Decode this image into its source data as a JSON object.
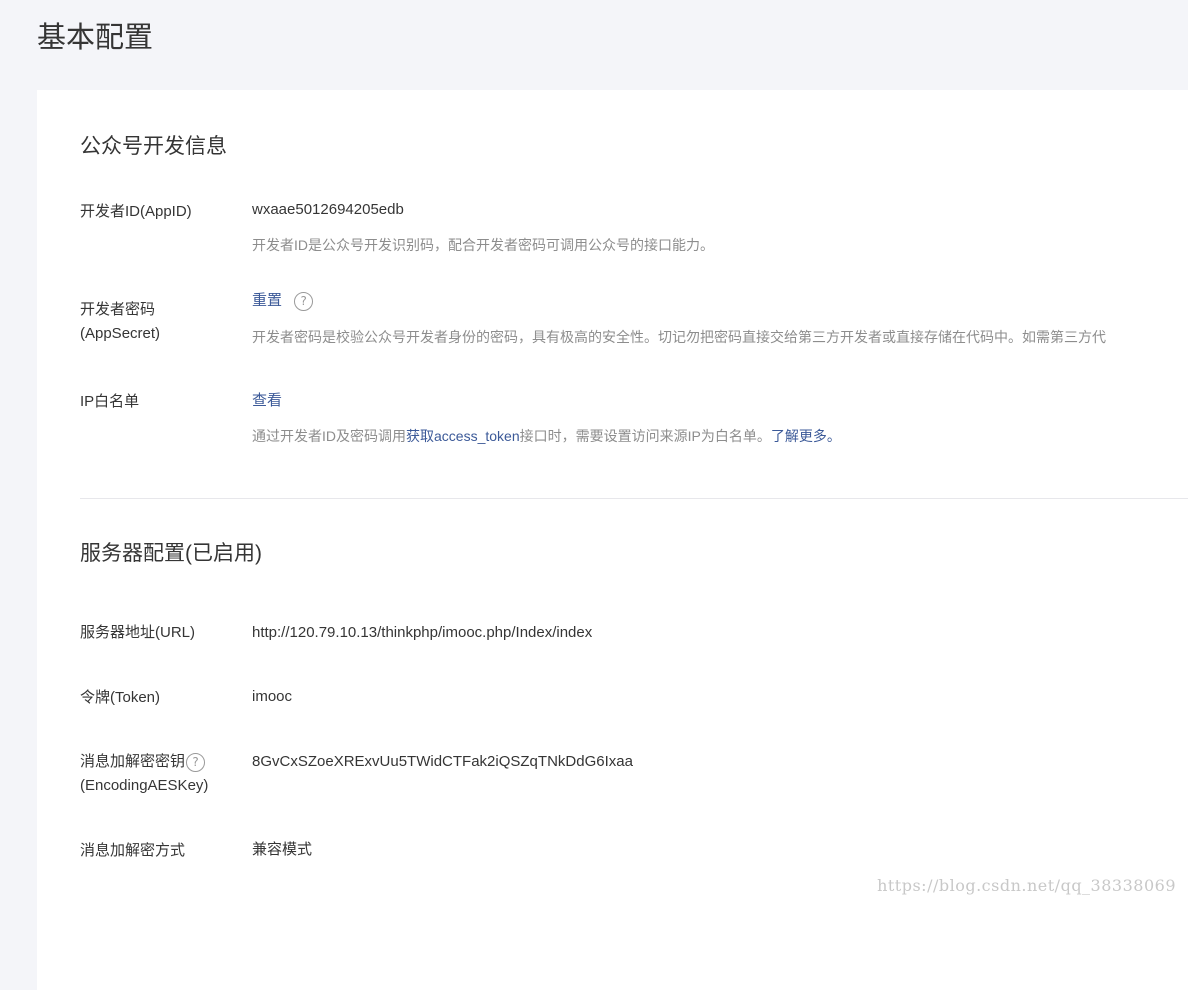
{
  "page_title": "基本配置",
  "dev_info": {
    "title": "公众号开发信息",
    "appid": {
      "label": "开发者ID(AppID)",
      "value": "wxaae5012694205edb",
      "desc": "开发者ID是公众号开发识别码，配合开发者密码可调用公众号的接口能力。"
    },
    "appsecret": {
      "label_line1": "开发者密码",
      "label_line2": "(AppSecret)",
      "action": "重置",
      "help": "?",
      "desc": "开发者密码是校验公众号开发者身份的密码，具有极高的安全性。切记勿把密码直接交给第三方开发者或直接存储在代码中。如需第三方代"
    },
    "ip_whitelist": {
      "label": "IP白名单",
      "action": "查看",
      "desc_prefix": "通过开发者ID及密码调用",
      "desc_link1": "获取access_token",
      "desc_middle": "接口时，需要设置访问来源IP为白名单。",
      "desc_link2": "了解更多。"
    }
  },
  "server_config": {
    "title": "服务器配置(已启用)",
    "url": {
      "label": "服务器地址(URL)",
      "value": "http://120.79.10.13/thinkphp/imooc.php/Index/index"
    },
    "token": {
      "label": "令牌(Token)",
      "value": "imooc"
    },
    "aeskey": {
      "label_line1": "消息加解密密钥",
      "label_line2": "(EncodingAESKey)",
      "help": "?",
      "value": "8GvCxSZoeXRExvUu5TWidCTFak2iQSZqTNkDdG6Ixaa"
    },
    "encrypt_mode": {
      "label": "消息加解密方式",
      "value": "兼容模式"
    }
  },
  "watermark": "https://blog.csdn.net/qq_38338069"
}
